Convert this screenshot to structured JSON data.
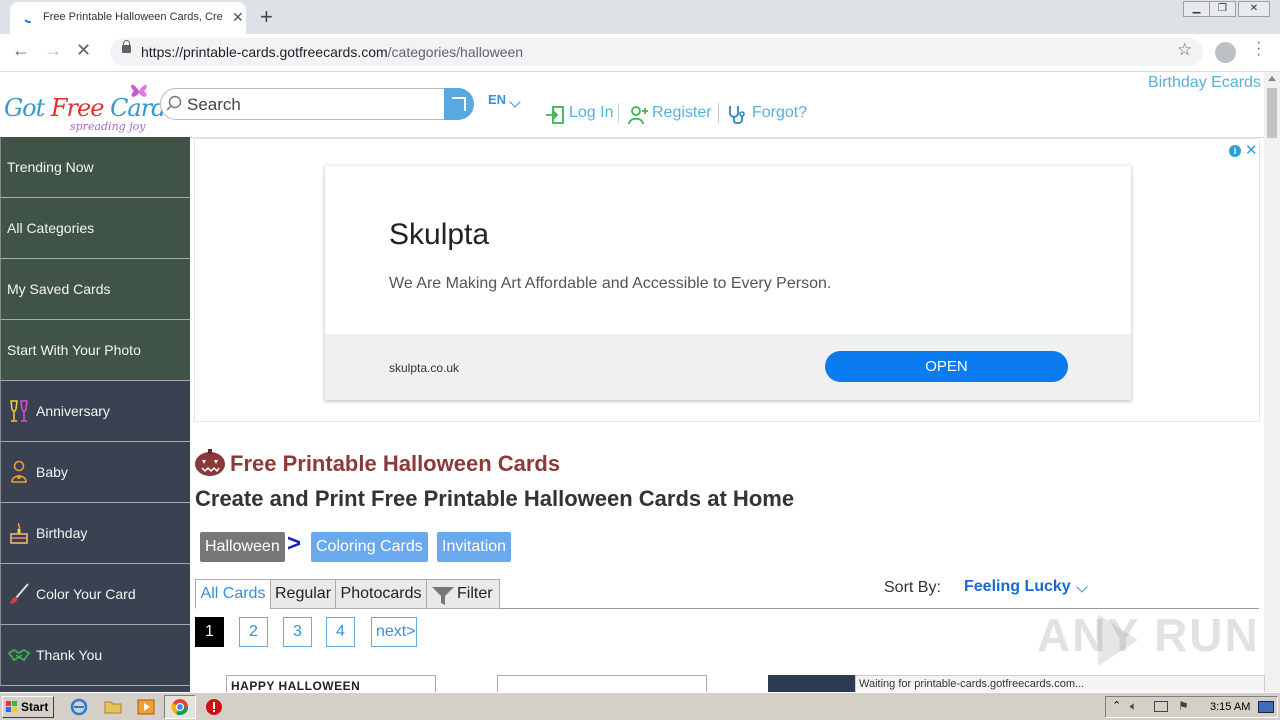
{
  "browser": {
    "tab_title": "Free Printable Halloween Cards, Cre",
    "url_host": "https://printable-cards.gotfreecards.com",
    "url_path": "/categories/halloween"
  },
  "header": {
    "logo_text_a": "Got ",
    "logo_text_b": "Free",
    "logo_text_c": " Cards",
    "logo_tagline": "spreading joy",
    "search_placeholder": "Search",
    "language": "EN",
    "login": "Log In",
    "register": "Register",
    "forgot": "Forgot?",
    "birthday_ecards": "Birthday Ecards"
  },
  "sidebar": {
    "items": [
      {
        "label": "Trending Now"
      },
      {
        "label": "All Categories"
      },
      {
        "label": "My Saved Cards"
      },
      {
        "label": "Start With Your Photo"
      },
      {
        "label": "Anniversary",
        "icon": "champagne-glasses-icon"
      },
      {
        "label": "Baby",
        "icon": "baby-icon"
      },
      {
        "label": "Birthday",
        "icon": "birthday-cake-icon"
      },
      {
        "label": "Color Your Card",
        "icon": "paint-brush-icon"
      },
      {
        "label": "Thank You",
        "icon": "handshake-icon"
      }
    ]
  },
  "ad": {
    "title": "Skulpta",
    "subtitle": "We Are Making Art Affordable and Accessible to Every Person.",
    "domain": "skulpta.co.uk",
    "cta": "OPEN"
  },
  "content": {
    "heading": "Free Printable Halloween Cards",
    "subheading": "Create and Print Free Printable Halloween Cards at Home",
    "breadcrumbs": [
      "Halloween",
      "Coloring Cards",
      "Invitation"
    ],
    "breadcrumb_separator": ">",
    "tabs": [
      "All Cards",
      "Regular",
      "Photocards",
      "Filter"
    ],
    "sort_label": "Sort By:",
    "sort_value": "Feeling Lucky",
    "pages": [
      "1",
      "2",
      "3",
      "4",
      "next>"
    ],
    "thumb_text": "HAPPY HALLOWEEN"
  },
  "status_text": "Waiting for printable-cards.gotfreecards.com...",
  "watermark": "ANY RUN",
  "taskbar": {
    "start_label": "Start",
    "clock": "3:15 AM"
  },
  "colors": {
    "sidebar_bg": "#3a4150",
    "sidebar_green": "#3f5446",
    "accent": "#3a8fd6",
    "heading": "#8b3a3a",
    "ad_button": "#0a7cf0"
  }
}
